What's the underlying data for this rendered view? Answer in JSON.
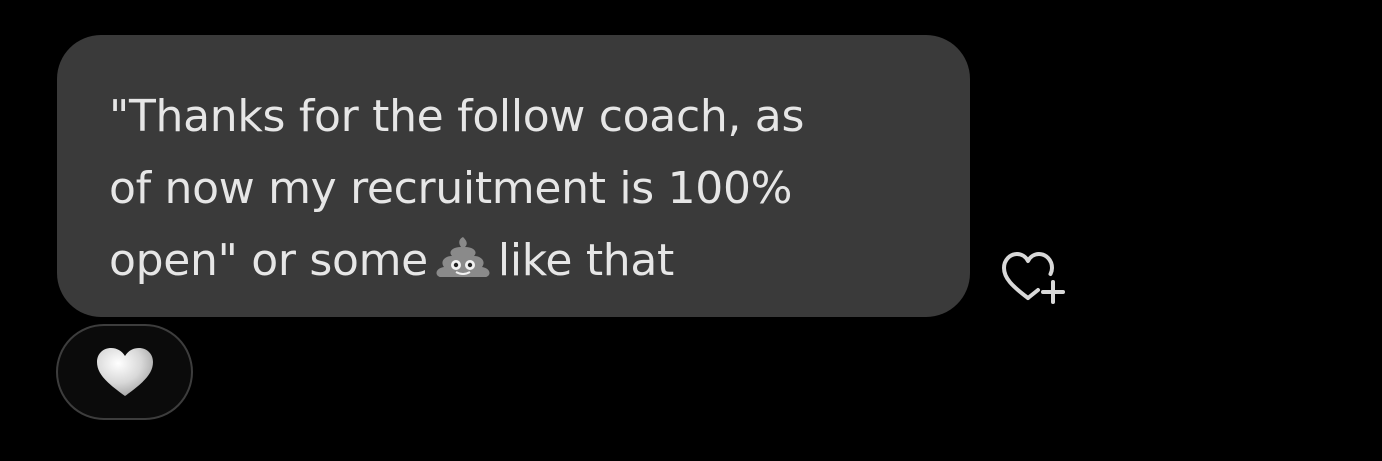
{
  "message": {
    "lines": [
      "\"Thanks for the follow coach, as",
      "of now my recruitment is 100%",
      "open\" or some"
    ],
    "line3_tail": "like that"
  },
  "icons": {
    "inline_emoji": "pile-of-poo-icon",
    "add_reaction": "heart-plus-icon",
    "reaction": "heart-icon"
  },
  "colors": {
    "background": "#000000",
    "bubble": "#3a3a3a",
    "text": "#e6e6e6",
    "reaction_border": "#3d3d3d"
  }
}
